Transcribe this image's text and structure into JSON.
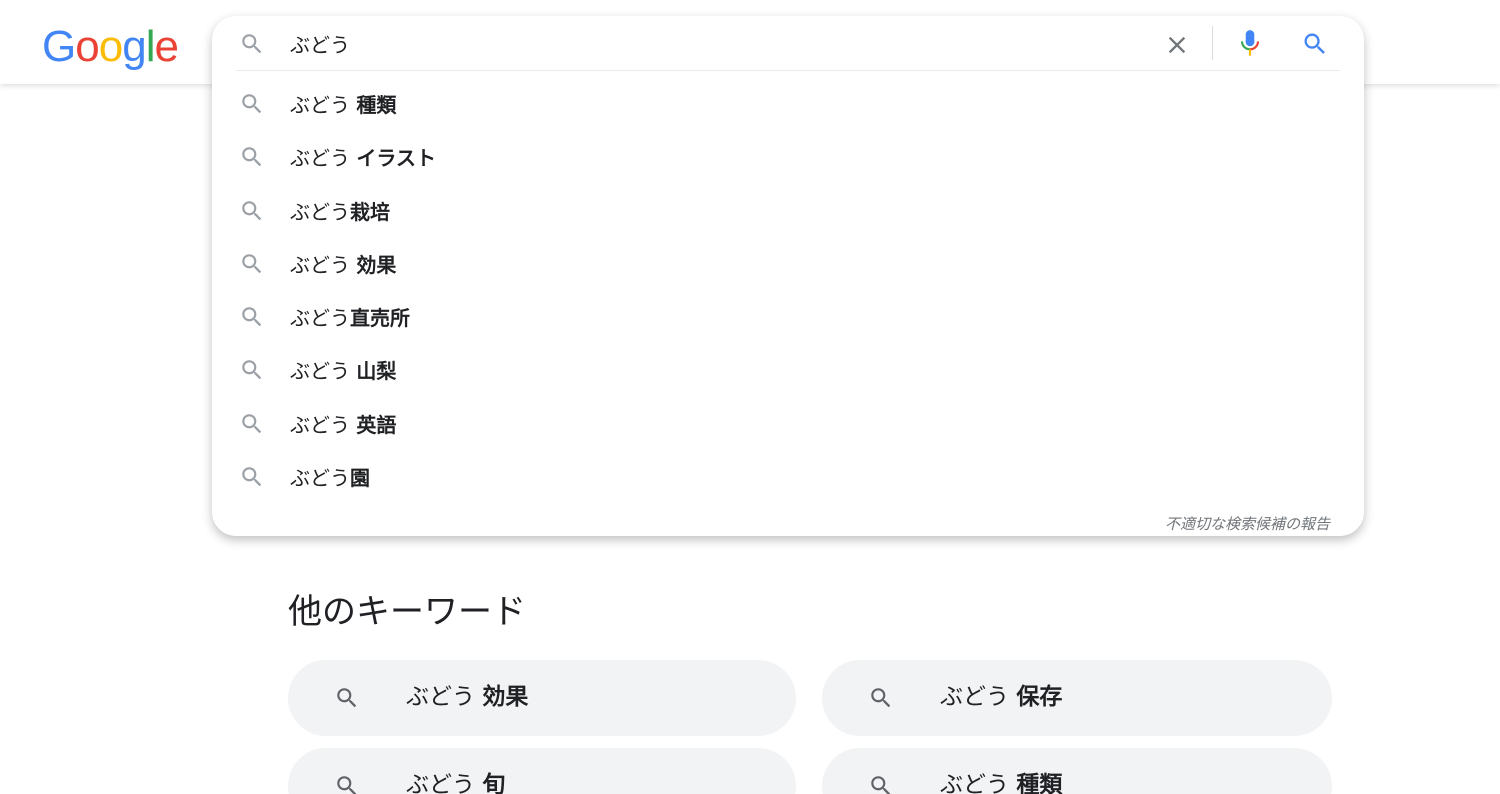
{
  "logo": {
    "letters": [
      "G",
      "o",
      "o",
      "g",
      "l",
      "e"
    ],
    "colors": [
      "#4285F4",
      "#EA4335",
      "#FBBC05",
      "#4285F4",
      "#34A853",
      "#EA4335"
    ]
  },
  "search": {
    "value": "ぶどう",
    "icons": {
      "lead": "search-icon",
      "clear": "close-icon",
      "voice": "mic-icon",
      "submit": "search-icon"
    }
  },
  "suggestions": [
    {
      "prefix": "ぶどう ",
      "bold": "種類"
    },
    {
      "prefix": "ぶどう ",
      "bold": "イラスト"
    },
    {
      "prefix": "ぶどう",
      "bold": "栽培"
    },
    {
      "prefix": "ぶどう ",
      "bold": "効果"
    },
    {
      "prefix": "ぶどう",
      "bold": "直売所"
    },
    {
      "prefix": "ぶどう ",
      "bold": "山梨"
    },
    {
      "prefix": "ぶどう ",
      "bold": "英語"
    },
    {
      "prefix": "ぶどう",
      "bold": "園"
    }
  ],
  "report_link": "不適切な検索候補の報告",
  "related": {
    "title": "他のキーワード",
    "chips": [
      {
        "prefix": "ぶどう ",
        "bold": "効果"
      },
      {
        "prefix": "ぶどう ",
        "bold": "保存"
      },
      {
        "prefix": "ぶどう ",
        "bold": "旬"
      },
      {
        "prefix": "ぶどう ",
        "bold": "種類"
      }
    ]
  },
  "colors": {
    "accent_blue": "#4285F4",
    "icon_gray": "#9aa0a6",
    "chip_bg": "#f1f3f4",
    "text": "#202124"
  }
}
